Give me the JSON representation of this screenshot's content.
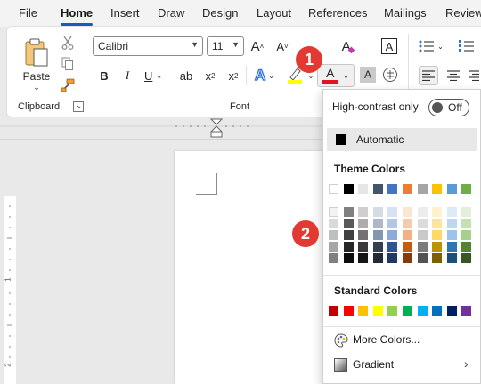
{
  "menu": {
    "tabs": [
      {
        "label": "File"
      },
      {
        "label": "Home",
        "active": true
      },
      {
        "label": "Insert"
      },
      {
        "label": "Draw"
      },
      {
        "label": "Design"
      },
      {
        "label": "Layout"
      },
      {
        "label": "References"
      },
      {
        "label": "Mailings"
      },
      {
        "label": "Review"
      }
    ]
  },
  "clipboard": {
    "paste_label": "Paste",
    "group_label": "Clipboard"
  },
  "font": {
    "name": "Calibri",
    "size": "11",
    "group_label": "Font",
    "buttons": {
      "bold": "B",
      "italic": "I",
      "underline": "U",
      "strike": "ab",
      "subscript": "x",
      "subscript_mark": "2",
      "superscript": "x",
      "superscript_mark": "2",
      "text_effects": "A",
      "font_color": "A",
      "char_shading": "A",
      "grow": "A",
      "shrink": "A",
      "clear_format": "A",
      "char_border": "A"
    },
    "accent_color": "#e81123",
    "highlight_color": "#ffff00"
  },
  "callouts": {
    "one": "1",
    "two": "2"
  },
  "color_menu": {
    "high_contrast_label": "High-contrast only",
    "toggle_state": "Off",
    "automatic_label": "Automatic",
    "automatic_color": "#000000",
    "theme_title": "Theme Colors",
    "theme_top": [
      "#ffffff",
      "#000000",
      "#e7e6e6",
      "#44546a",
      "#4472c4",
      "#ed7d31",
      "#a5a5a5",
      "#ffc000",
      "#5b9bd5",
      "#70ad47"
    ],
    "theme_shades": [
      [
        "#f2f2f2",
        "#d9d9d9",
        "#bfbfbf",
        "#a6a6a6",
        "#808080"
      ],
      [
        "#808080",
        "#595959",
        "#404040",
        "#262626",
        "#0d0d0d"
      ],
      [
        "#d0cece",
        "#aeabab",
        "#757171",
        "#3a3838",
        "#171616"
      ],
      [
        "#d6dce4",
        "#adb9ca",
        "#8497b0",
        "#333f4f",
        "#222a35"
      ],
      [
        "#d9e2f3",
        "#b4c6e7",
        "#8eaadb",
        "#2f5496",
        "#1f3864"
      ],
      [
        "#fbe5d5",
        "#f7caac",
        "#f4b183",
        "#c55a11",
        "#833c0b"
      ],
      [
        "#ededed",
        "#dbdbdb",
        "#c9c9c9",
        "#7b7b7b",
        "#525252"
      ],
      [
        "#fff2cc",
        "#ffe599",
        "#ffd966",
        "#bf9000",
        "#7f6000"
      ],
      [
        "#deebf6",
        "#bdd7ee",
        "#9dc3e6",
        "#2e75b5",
        "#1e4e79"
      ],
      [
        "#e2efd9",
        "#c5e0b3",
        "#a8d08d",
        "#538135",
        "#375623"
      ]
    ],
    "standard_title": "Standard Colors",
    "standard": [
      "#c00000",
      "#ff0000",
      "#ffc000",
      "#ffff00",
      "#92d050",
      "#00b050",
      "#00b0f0",
      "#0070c0",
      "#002060",
      "#7030a0"
    ],
    "more_colors_label": "More Colors...",
    "gradient_label": "Gradient"
  },
  "ruler": {
    "v_ticks": [
      "1",
      "2"
    ]
  }
}
